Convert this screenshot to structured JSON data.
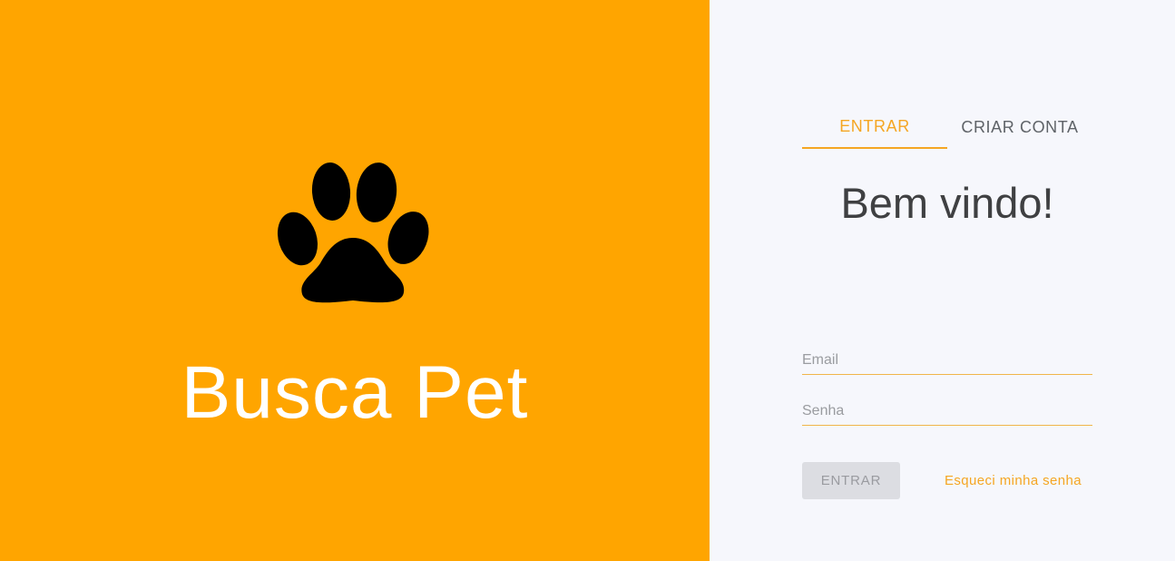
{
  "brand": {
    "title": "Busca Pet",
    "icon": "paw-icon",
    "background": "#FFA500"
  },
  "tabs": [
    {
      "label": "ENTRAR",
      "active": true
    },
    {
      "label": "CRIAR CONTA",
      "active": false
    }
  ],
  "form": {
    "heading": "Bem vindo!",
    "email": {
      "placeholder": "Email",
      "value": ""
    },
    "password": {
      "placeholder": "Senha",
      "value": ""
    },
    "submit_label": "ENTRAR",
    "submit_disabled": true,
    "forgot_label": "Esqueci minha senha"
  },
  "colors": {
    "accent": "#F5A623",
    "panel_bg": "#F6F7FC",
    "text_dark": "#3f4042"
  }
}
